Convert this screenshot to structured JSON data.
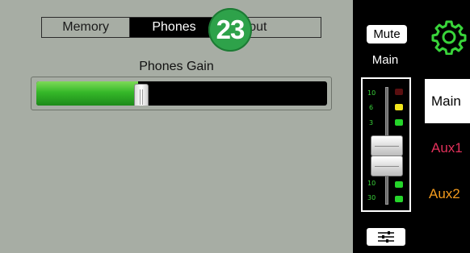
{
  "tabs": [
    {
      "label": "Memory",
      "active": false
    },
    {
      "label": "Phones",
      "active": true
    },
    {
      "label": "About",
      "active": false
    }
  ],
  "badge": "23",
  "phones_gain": {
    "label": "Phones Gain",
    "level": 0.35
  },
  "channel": {
    "mute_label": "Mute",
    "name": "Main",
    "scale_top": [
      "10",
      "6",
      "3"
    ],
    "scale_bottom": [
      "10",
      "30"
    ],
    "eq_icon": "sliders-icon"
  },
  "mix_buses": {
    "settings_icon": "gear-icon",
    "items": [
      {
        "label": "Main",
        "color": "#000000",
        "selected": true
      },
      {
        "label": "Aux1",
        "color": "#e0305a",
        "selected": false
      },
      {
        "label": "Aux2",
        "color": "#f29a1d",
        "selected": false
      }
    ]
  },
  "colors": {
    "accent_green": "#39d43a",
    "badge_green": "#2ea24a"
  }
}
